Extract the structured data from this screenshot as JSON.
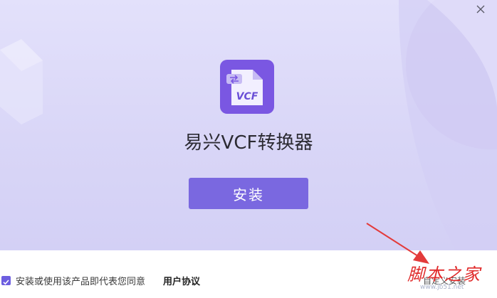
{
  "app": {
    "title": "易兴VCF转换器",
    "icon_label": "VCF"
  },
  "window": {
    "close_glyph": "×"
  },
  "install": {
    "label": "安装"
  },
  "footer": {
    "agreement_text": "安装或使用该产品即代表您同意",
    "agreement_link": "用户协议",
    "custom_option": "自定义安装"
  },
  "watermark": {
    "main": "脚本之家",
    "sub": "www.jb51.net"
  },
  "colors": {
    "accent": "#7a68e0",
    "icon_bg": "#7a57e2",
    "panel_bg": "#dcd9f8",
    "arrow": "#e33b3b"
  }
}
